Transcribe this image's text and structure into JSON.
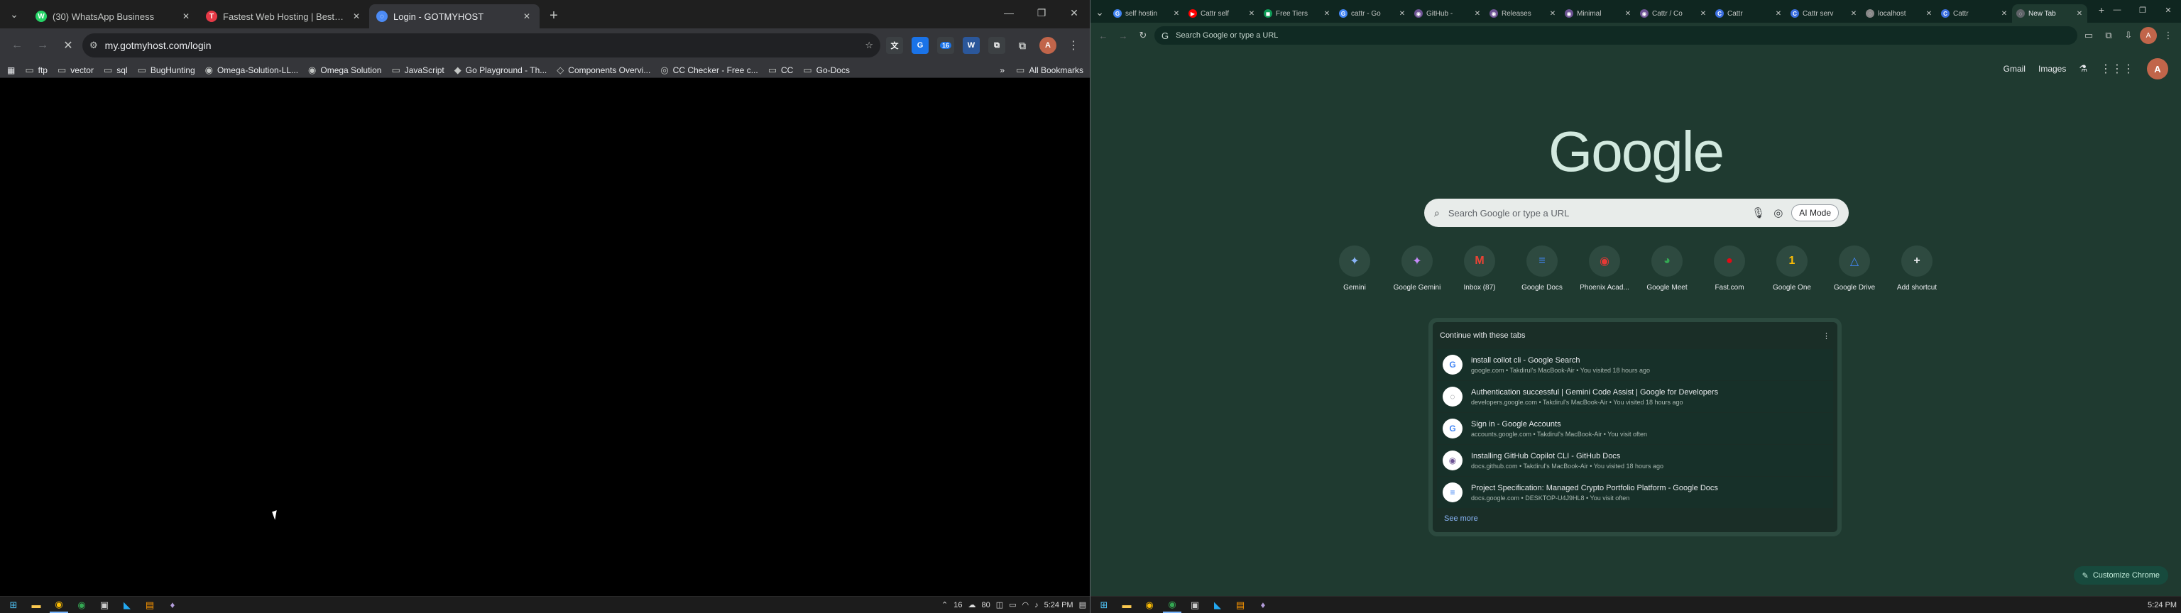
{
  "left_browser": {
    "tabs": [
      {
        "title": "(30) WhatsApp Business",
        "icon": "whatsapp-icon",
        "color": "#25d366",
        "glyph": "W",
        "active": false
      },
      {
        "title": "Fastest Web Hosting | Best VPS",
        "icon": "hosting-icon",
        "color": "#e63946",
        "glyph": "T",
        "active": false
      },
      {
        "title": "Login - GOTMYHOST",
        "icon": "gotmyhost-icon",
        "color": "#4c8bf5",
        "glyph": "◌",
        "active": true
      }
    ],
    "url": "my.gotmyhost.com/login",
    "bookmarks": [
      {
        "label": "ftp",
        "icon": "folder-icon"
      },
      {
        "label": "vector",
        "icon": "folder-icon"
      },
      {
        "label": "sql",
        "icon": "folder-icon"
      },
      {
        "label": "BugHunting",
        "icon": "folder-icon"
      },
      {
        "label": "Omega-Solution-LL...",
        "icon": "github-icon"
      },
      {
        "label": "Omega Solution",
        "icon": "github-icon"
      },
      {
        "label": "JavaScript",
        "icon": "folder-icon"
      },
      {
        "label": "Go Playground - Th...",
        "icon": "go-icon"
      },
      {
        "label": "Components Overvi...",
        "icon": "component-icon"
      },
      {
        "label": "CC Checker - Free c...",
        "icon": "globe-icon"
      },
      {
        "label": "CC",
        "icon": "folder-icon"
      },
      {
        "label": "Go-Docs",
        "icon": "folder-icon"
      }
    ],
    "all_bookmarks": "All Bookmarks",
    "taskbar_time": "5:24 PM",
    "tray_nums": [
      "16",
      "80"
    ],
    "extension_badge": "16"
  },
  "right_browser": {
    "tabs": [
      {
        "title": "self hostin",
        "color": "#4285f4",
        "glyph": "G"
      },
      {
        "title": "Cattr self",
        "color": "#ff0000",
        "glyph": "▶"
      },
      {
        "title": "Free Tiers",
        "color": "#0f9d58",
        "glyph": "◼"
      },
      {
        "title": "cattr - Go",
        "color": "#4285f4",
        "glyph": "G"
      },
      {
        "title": "GitHub - ",
        "color": "#6e5494",
        "glyph": "◉"
      },
      {
        "title": "Releases",
        "color": "#6e5494",
        "glyph": "◉"
      },
      {
        "title": "Minimal",
        "color": "#6e5494",
        "glyph": "◉"
      },
      {
        "title": "Cattr / Co",
        "color": "#6e5494",
        "glyph": "◉"
      },
      {
        "title": "Cattr",
        "color": "#3b6fe0",
        "glyph": "C"
      },
      {
        "title": "Cattr serv",
        "color": "#3b6fe0",
        "glyph": "C"
      },
      {
        "title": "localhost",
        "color": "#888888",
        "glyph": "◌"
      },
      {
        "title": "Cattr",
        "color": "#3b6fe0",
        "glyph": "C"
      },
      {
        "title": "New Tab",
        "color": "#5f6368",
        "glyph": "◌",
        "active": true
      }
    ],
    "omnibox_placeholder": "Search Google or type a URL",
    "top_links": [
      "Gmail",
      "Images"
    ],
    "avatar_initial": "A",
    "logo": "Google",
    "search_placeholder": "Search Google or type a URL",
    "ai_mode": "AI Mode",
    "shortcuts": [
      {
        "label": "Gemini",
        "glyph": "✦",
        "color": "#8ab4f8"
      },
      {
        "label": "Google Gemini",
        "glyph": "✦",
        "color": "#c58af9"
      },
      {
        "label": "Inbox (87)",
        "glyph": "M",
        "color": "#ea4335"
      },
      {
        "label": "Google Docs",
        "glyph": "≡",
        "color": "#4285f4"
      },
      {
        "label": "Phoenix Acad...",
        "glyph": "◉",
        "color": "#e53935"
      },
      {
        "label": "Google Meet",
        "glyph": "◕",
        "color": "#34a853"
      },
      {
        "label": "Fast.com",
        "glyph": "●",
        "color": "#e50914"
      },
      {
        "label": "Google One",
        "glyph": "1",
        "color": "#fbbc04"
      },
      {
        "label": "Google Drive",
        "glyph": "△",
        "color": "#4285f4"
      },
      {
        "label": "Add shortcut",
        "glyph": "+",
        "color": "#e8eaed"
      }
    ],
    "continue_title": "Continue with these tabs",
    "continue_items": [
      {
        "title": "install collot cli - Google Search",
        "sub": "google.com • Takdirul's MacBook-Air • You visited 18 hours ago",
        "glyph": "G",
        "color": "#4285f4"
      },
      {
        "title": "Authentication successful | Gemini Code Assist | Google for Developers",
        "sub": "developers.google.com • Takdirul's MacBook-Air • You visited 18 hours ago",
        "glyph": "◌",
        "color": "#5f6368"
      },
      {
        "title": "Sign in - Google Accounts",
        "sub": "accounts.google.com • Takdirul's MacBook-Air • You visit often",
        "glyph": "G",
        "color": "#4285f4"
      },
      {
        "title": "Installing GitHub Copilot CLI - GitHub Docs",
        "sub": "docs.github.com • Takdirul's MacBook-Air • You visited 18 hours ago",
        "glyph": "◉",
        "color": "#6e5494"
      },
      {
        "title": "Project Specification: Managed Crypto Portfolio Platform - Google Docs",
        "sub": "docs.google.com • DESKTOP-U4J9HL8 • You visit often",
        "glyph": "≡",
        "color": "#4285f4"
      }
    ],
    "see_more": "See more",
    "customize": "Customize Chrome",
    "taskbar_time": "5:24 PM"
  }
}
